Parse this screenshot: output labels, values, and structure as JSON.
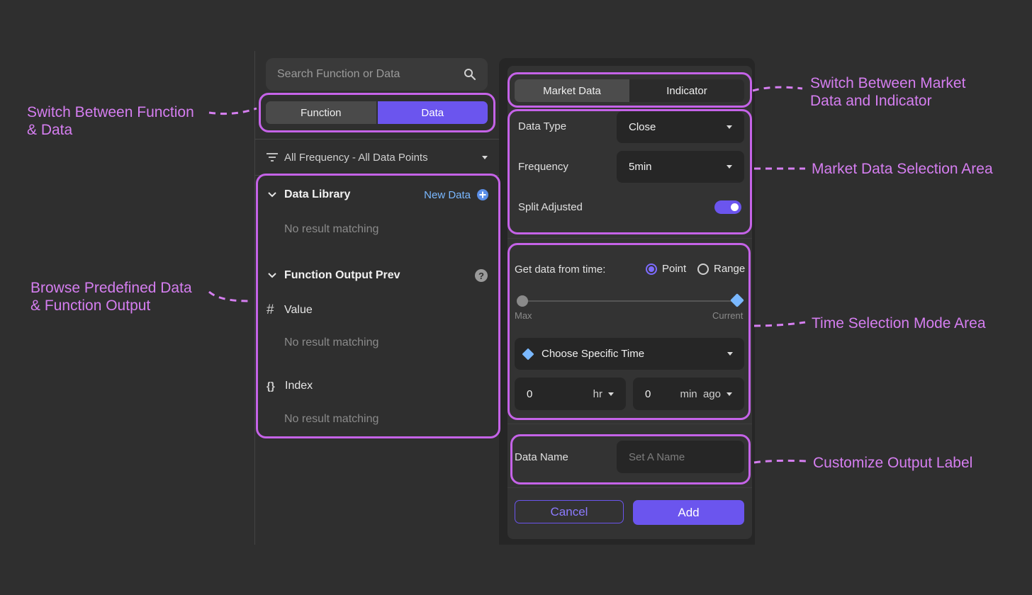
{
  "left": {
    "search_placeholder": "Search Function or Data",
    "tabs": [
      "Function",
      "Data"
    ],
    "active_tab": "Data",
    "filter_label": "All Frequency - All Data Points",
    "data_library": {
      "title": "Data Library",
      "new_data_label": "New Data",
      "empty": "No result matching"
    },
    "function_output": {
      "title": "Function Output Prev",
      "value_label": "Value",
      "value_empty": "No result matching",
      "index_label": "Index",
      "index_empty": "No result matching"
    }
  },
  "right": {
    "tabs": [
      "Market Data",
      "Indicator"
    ],
    "active_tab": "Market Data",
    "data_type": {
      "label": "Data Type",
      "value": "Close"
    },
    "frequency": {
      "label": "Frequency",
      "value": "5min"
    },
    "split_adjusted": {
      "label": "Split Adjusted",
      "enabled": true
    },
    "time": {
      "label": "Get data from time:",
      "options": [
        "Point",
        "Range"
      ],
      "selected": "Point",
      "slider_min_label": "Max",
      "slider_max_label": "Current",
      "slider_value": 1.0,
      "mode_value": "Choose Specific Time",
      "hours_value": "0",
      "hours_unit": "hr",
      "minutes_value": "0",
      "minutes_unit": "min  ago"
    },
    "data_name": {
      "label": "Data Name",
      "placeholder": "Set A Name"
    },
    "cancel_label": "Cancel",
    "add_label": "Add"
  },
  "annotations": {
    "switch_function_data": [
      "Switch Between Function",
      "& Data"
    ],
    "browse": [
      "Browse Predefined Data",
      "& Function Output"
    ],
    "switch_market": [
      "Switch Between Market",
      "Data and Indicator"
    ],
    "market_selection": "Market Data Selection Area",
    "time_selection": "Time Selection Mode Area",
    "output_label": "Customize Output Label"
  },
  "colors": {
    "accent": "#6b55ee",
    "annotation": "#d57ef0",
    "link": "#7ab8ff"
  }
}
